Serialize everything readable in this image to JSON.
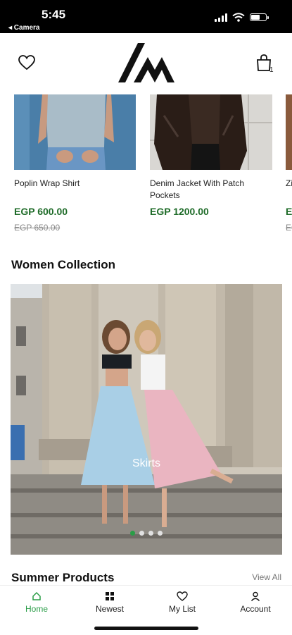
{
  "status": {
    "time": "5:45",
    "back_label": "◂ Camera",
    "battery_level": 0.6
  },
  "header": {
    "cart_count": "1"
  },
  "products": [
    {
      "name": "Poplin Wrap Shirt",
      "price": "EGP 600.00",
      "old_price": "EGP 650.00"
    },
    {
      "name": "Denim Jacket With Patch Pockets",
      "price": "EGP 1200.00",
      "old_price": ""
    },
    {
      "name": "Zi",
      "price": "EG",
      "old_price": "EG"
    }
  ],
  "women": {
    "title": "Women Collection",
    "banner_label": "Skirts",
    "dots_total": 4,
    "dots_active": 1
  },
  "summer": {
    "title": "Summer Products",
    "view_all": "View All"
  },
  "nav": {
    "home": "Home",
    "newest": "Newest",
    "my_list": "My List",
    "account": "Account"
  },
  "colors": {
    "accent": "#2a9d47",
    "price": "#1e6b28"
  }
}
